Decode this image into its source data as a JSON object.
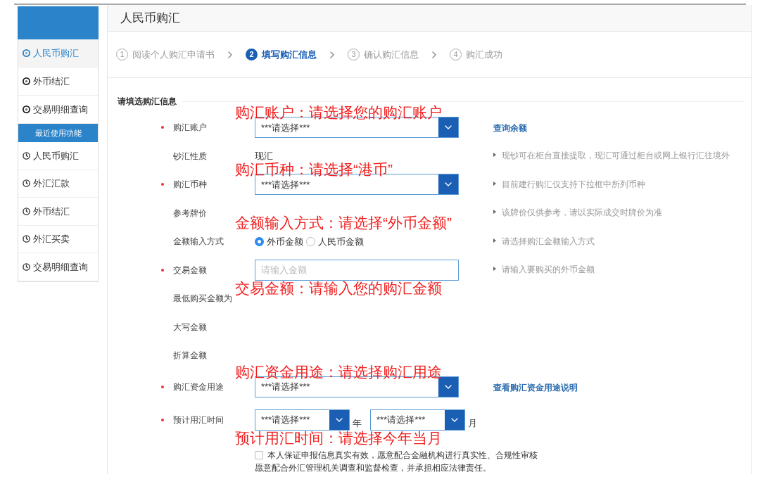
{
  "sidebar": {
    "items": [
      {
        "label": "人民币购汇",
        "selected": true
      },
      {
        "label": "外币结汇",
        "selected": false
      },
      {
        "label": "交易明细查询",
        "selected": false
      }
    ],
    "recent_title": "最近使用功能",
    "recent": [
      {
        "label": "人民币购汇"
      },
      {
        "label": "外汇汇款"
      },
      {
        "label": "外币结汇"
      },
      {
        "label": "外汇买卖"
      },
      {
        "label": "交易明细查询"
      }
    ]
  },
  "page_title": "人民币购汇",
  "steps": [
    {
      "number": "1",
      "label": "阅读个人购汇申请书",
      "selected": false
    },
    {
      "number": "2",
      "label": "填写购汇信息",
      "selected": true
    },
    {
      "number": "3",
      "label": "确认购汇信息",
      "selected": false
    },
    {
      "number": "4",
      "label": "购汇成功",
      "selected": false
    }
  ],
  "section_title": "请填选购汇信息",
  "rows": [
    {
      "kind": "select",
      "required": true,
      "label": "购汇账户",
      "value": "***请选择***",
      "link": "查询余额",
      "annotation": "购汇账户：请选择您的购汇账户"
    },
    {
      "kind": "text",
      "required": false,
      "label": "钞汇性质",
      "value": "现汇",
      "hint": "现钞可在柜台直接提取，现汇可通过柜台或网上银行汇往境外"
    },
    {
      "kind": "select",
      "required": true,
      "label": "购汇币种",
      "value": "***请选择***",
      "hint": "目前建行购汇仅支持下拉框中所列币种",
      "annotation": "购汇币种：请选择“港币”"
    },
    {
      "kind": "text",
      "required": false,
      "label": "参考牌价",
      "hint": "该牌价仅供参考，请以实际成交时牌价为准"
    },
    {
      "kind": "radio",
      "required": false,
      "label": "金额输入方式",
      "options": [
        {
          "label": "外币金额",
          "selected": true
        },
        {
          "label": "人民币金额",
          "selected": false
        }
      ],
      "hint": "请选择购汇金额输入方式",
      "annotation": "金额输入方式：请选择“外币金额”"
    },
    {
      "kind": "input",
      "required": true,
      "label": "交易金额",
      "placeholder": "请输入金额",
      "hint": "请输入要购买的外币金额",
      "annotation": "交易金额：请输入您的购汇金额"
    },
    {
      "kind": "text",
      "required": false,
      "label": "最低购买金额为"
    },
    {
      "kind": "text",
      "required": false,
      "label": "大写金额"
    },
    {
      "kind": "text",
      "required": false,
      "label": "折算金额"
    },
    {
      "kind": "select",
      "required": true,
      "label": "购汇资金用途",
      "value": "***请选择***",
      "link": "查看购汇资金用途说明",
      "annotation": "购汇资金用途：请选择购汇用途"
    },
    {
      "kind": "date",
      "required": true,
      "label": "预计用汇时间",
      "parts": [
        {
          "value": "***请选择***",
          "unit": "年"
        },
        {
          "value": "***请选择***",
          "unit": "月"
        }
      ],
      "annotation": "预计用汇时间：请选择今年当月"
    }
  ],
  "agreement": {
    "checked": false,
    "lines": [
      "本人保证申报信息真实有效，愿意配合金融机构进行真实性、合规性审核",
      "愿意配合外汇管理机关调查和监督检查，并承担相应法律责任。"
    ]
  }
}
